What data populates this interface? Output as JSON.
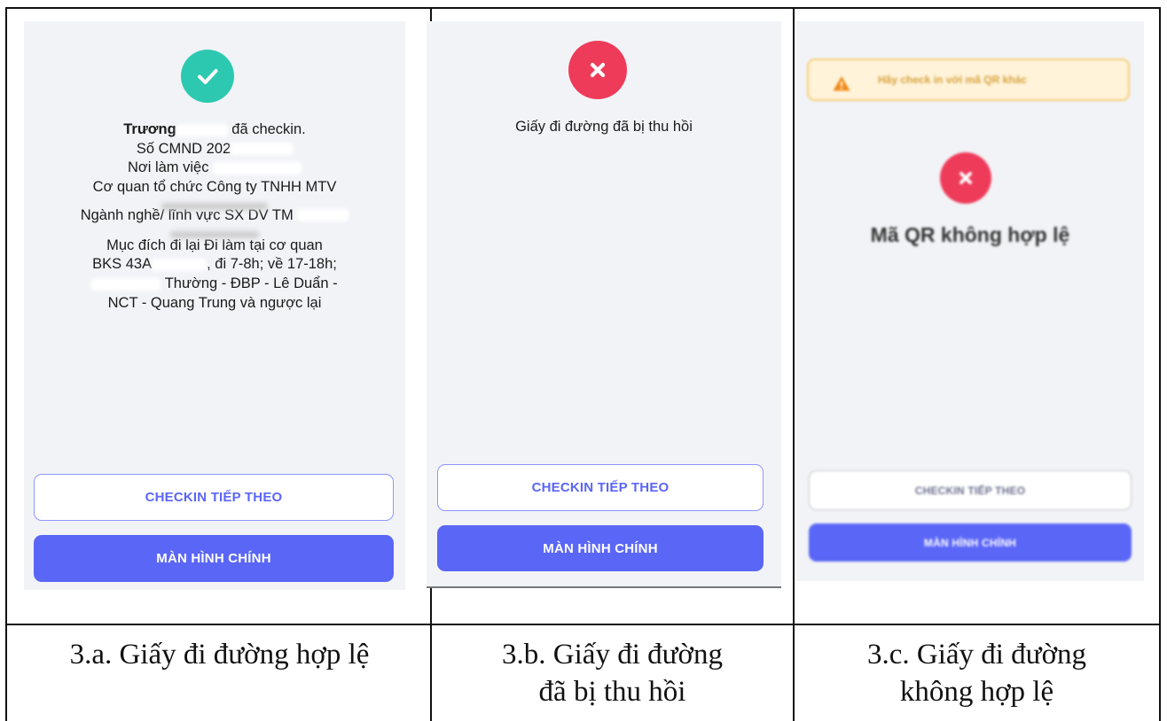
{
  "colors": {
    "success": "#2cc9b0",
    "error": "#ef3b5a",
    "primary": "#5a66f6",
    "warning_bg": "#fff3da"
  },
  "panel_a": {
    "icon": "check-icon",
    "lines": [
      {
        "bold": "Trương",
        "rest": " đã checkin."
      },
      {
        "text": "Số CMND 202"
      },
      {
        "text": "Nơi làm việc"
      },
      {
        "text": "Cơ quan tổ chức Công ty TNHH MTV"
      },
      {
        "text": ""
      },
      {
        "text": "Ngành nghề/ lĩnh vực SX DV TM"
      },
      {
        "text": ""
      },
      {
        "text": "Mục đích đi lại Đi làm tại cơ quan"
      },
      {
        "text": "BKS 43A"
      },
      {
        "text": ", đi 7-8h; về 17-18h;"
      },
      {
        "text": "Thường - ĐBP - Lê Duẩn -"
      },
      {
        "text": "NCT - Quang Trung và ngược lại"
      }
    ],
    "btn_next": "CHECKIN TIẾP THEO",
    "btn_home": "MÀN HÌNH CHÍNH",
    "caption": "3.a. Giấy đi đường hợp lệ"
  },
  "panel_b": {
    "icon": "close-icon",
    "message": "Giấy đi đường đã bị thu hồi",
    "btn_next": "CHECKIN TIẾP THEO",
    "btn_home": "MÀN HÌNH CHÍNH",
    "caption_l1": "3.b. Giấy đi đường",
    "caption_l2": "đã bị thu hồi"
  },
  "panel_c": {
    "warn_icon": "warning-icon",
    "warning": "Hãy check in với mã QR khác",
    "icon": "close-icon",
    "message": "Mã QR không hợp lệ",
    "btn_next": "CHECKIN TIẾP THEO",
    "btn_home": "MÀN HÌNH CHÍNH",
    "caption_l1": "3.c. Giấy đi đường",
    "caption_l2": "không hợp lệ"
  }
}
